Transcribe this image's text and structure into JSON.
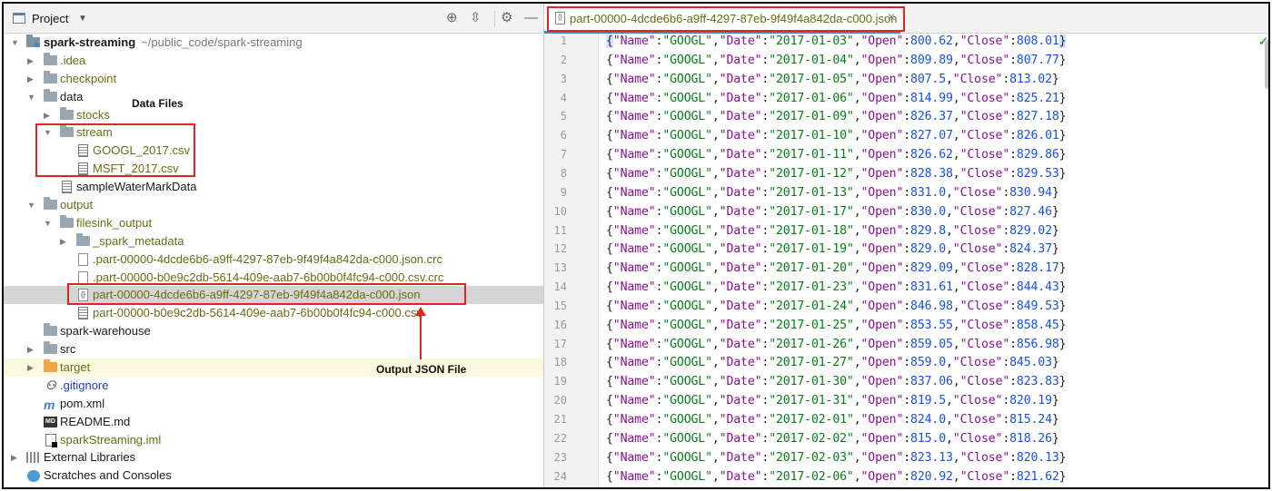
{
  "project_header": {
    "title": "Project"
  },
  "tree": {
    "root_name": "spark-streaming",
    "root_path": "~/public_code/spark-streaming",
    "idea": ".idea",
    "checkpoint": "checkpoint",
    "data": "data",
    "stocks": "stocks",
    "stream": "stream",
    "googl_csv": "GOOGL_2017.csv",
    "msft_csv": "MSFT_2017.csv",
    "sample_watermark": "sampleWaterMarkData",
    "output": "output",
    "filesink_output": "filesink_output",
    "spark_metadata": "_spark_metadata",
    "json_crc": ".part-00000-4dcde6b6-a9ff-4297-87eb-9f49f4a842da-c000.json.crc",
    "csv_crc": ".part-00000-b0e9c2db-5614-409e-aab7-6b00b0f4fc94-c000.csv.crc",
    "json_file": "part-00000-4dcde6b6-a9ff-4297-87eb-9f49f4a842da-c000.json",
    "csv_file": "part-00000-b0e9c2db-5614-409e-aab7-6b00b0f4fc94-c000.csv",
    "spark_warehouse": "spark-warehouse",
    "src": "src",
    "target": "target",
    "gitignore": ".gitignore",
    "pom": "pom.xml",
    "readme": "README.md",
    "iml": "sparkStreaming.iml",
    "external_libraries": "External Libraries",
    "scratches": "Scratches and Consoles"
  },
  "annotations": {
    "data_files": "Data Files",
    "output_json": "Output JSON File",
    "color": "#e02424"
  },
  "editor": {
    "tab_label": "part-00000-4dcde6b6-a9ff-4297-87eb-9f49f4a842da-c000.json",
    "records": [
      {
        "line": "1",
        "name": "GOOGL",
        "date": "2017-01-03",
        "open": "800.62",
        "close": "808.01"
      },
      {
        "line": "2",
        "name": "GOOGL",
        "date": "2017-01-04",
        "open": "809.89",
        "close": "807.77"
      },
      {
        "line": "3",
        "name": "GOOGL",
        "date": "2017-01-05",
        "open": "807.5",
        "close": "813.02"
      },
      {
        "line": "4",
        "name": "GOOGL",
        "date": "2017-01-06",
        "open": "814.99",
        "close": "825.21"
      },
      {
        "line": "5",
        "name": "GOOGL",
        "date": "2017-01-09",
        "open": "826.37",
        "close": "827.18"
      },
      {
        "line": "6",
        "name": "GOOGL",
        "date": "2017-01-10",
        "open": "827.07",
        "close": "826.01"
      },
      {
        "line": "7",
        "name": "GOOGL",
        "date": "2017-01-11",
        "open": "826.62",
        "close": "829.86"
      },
      {
        "line": "8",
        "name": "GOOGL",
        "date": "2017-01-12",
        "open": "828.38",
        "close": "829.53"
      },
      {
        "line": "9",
        "name": "GOOGL",
        "date": "2017-01-13",
        "open": "831.0",
        "close": "830.94"
      },
      {
        "line": "10",
        "name": "GOOGL",
        "date": "2017-01-17",
        "open": "830.0",
        "close": "827.46"
      },
      {
        "line": "11",
        "name": "GOOGL",
        "date": "2017-01-18",
        "open": "829.8",
        "close": "829.02"
      },
      {
        "line": "12",
        "name": "GOOGL",
        "date": "2017-01-19",
        "open": "829.0",
        "close": "824.37"
      },
      {
        "line": "13",
        "name": "GOOGL",
        "date": "2017-01-20",
        "open": "829.09",
        "close": "828.17"
      },
      {
        "line": "14",
        "name": "GOOGL",
        "date": "2017-01-23",
        "open": "831.61",
        "close": "844.43"
      },
      {
        "line": "15",
        "name": "GOOGL",
        "date": "2017-01-24",
        "open": "846.98",
        "close": "849.53"
      },
      {
        "line": "16",
        "name": "GOOGL",
        "date": "2017-01-25",
        "open": "853.55",
        "close": "858.45"
      },
      {
        "line": "17",
        "name": "GOOGL",
        "date": "2017-01-26",
        "open": "859.05",
        "close": "856.98"
      },
      {
        "line": "18",
        "name": "GOOGL",
        "date": "2017-01-27",
        "open": "859.0",
        "close": "845.03"
      },
      {
        "line": "19",
        "name": "GOOGL",
        "date": "2017-01-30",
        "open": "837.06",
        "close": "823.83"
      },
      {
        "line": "20",
        "name": "GOOGL",
        "date": "2017-01-31",
        "open": "819.5",
        "close": "820.19"
      },
      {
        "line": "21",
        "name": "GOOGL",
        "date": "2017-02-01",
        "open": "824.0",
        "close": "815.24"
      },
      {
        "line": "22",
        "name": "GOOGL",
        "date": "2017-02-02",
        "open": "815.0",
        "close": "818.26"
      },
      {
        "line": "23",
        "name": "GOOGL",
        "date": "2017-02-03",
        "open": "823.13",
        "close": "820.13"
      },
      {
        "line": "24",
        "name": "GOOGL",
        "date": "2017-02-06",
        "open": "820.92",
        "close": "821.62"
      }
    ]
  }
}
